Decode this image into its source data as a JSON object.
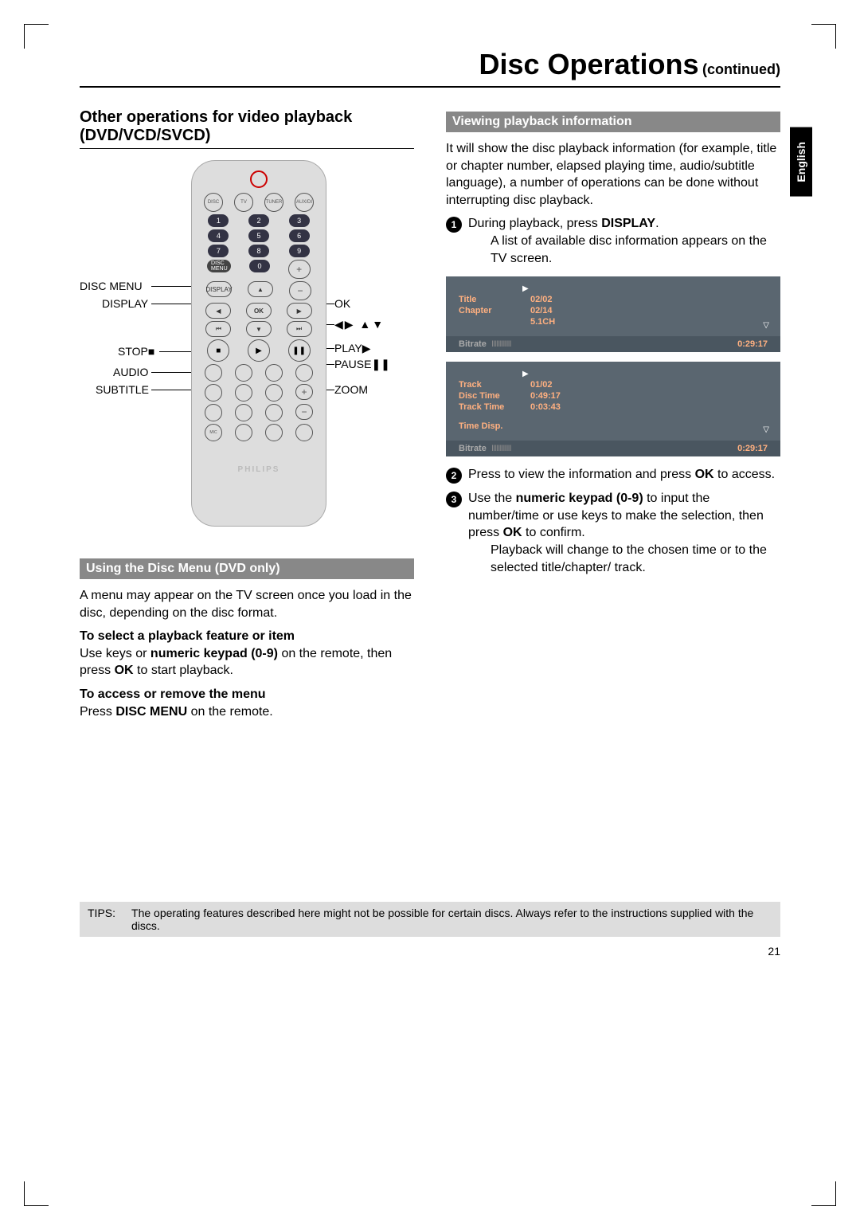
{
  "page": {
    "title_main": "Disc Operations",
    "title_sub": "(continued)",
    "lang_tab": "English",
    "page_number": "21"
  },
  "left": {
    "heading": "Other operations for video playback (DVD/VCD/SVCD)",
    "remote_labels": {
      "disc_menu": "DISC MENU",
      "display": "DISPLAY",
      "stop": "STOP",
      "audio": "AUDIO",
      "subtitle": "SUBTITLE",
      "ok": "OK",
      "arrows": "◀▶ ▲▼",
      "play": "PLAY",
      "pause": "PAUSE",
      "zoom": "ZOOM"
    },
    "sub1": "Using the Disc Menu (DVD only)",
    "p1": "A menu may appear on the TV screen once you load in the disc, depending on the disc format.",
    "p2_bold": "To select a playback feature or item",
    "p2a": "Use ",
    "p2b": " keys or ",
    "p2c": "numeric keypad (0-9)",
    "p2d": " on the remote, then press ",
    "p2e": "OK",
    "p2f": " to start playback.",
    "p3_bold": "To access or remove the menu",
    "p3a": "Press ",
    "p3b": "DISC MENU",
    "p3c": " on the remote."
  },
  "right": {
    "sub1": "Viewing playback information",
    "p1": "It will show the disc playback information (for example, title or chapter number, elapsed playing time, audio/subtitle language), a number of operations can be done without interrupting disc playback.",
    "step1a": "During playback, press ",
    "step1b": "DISPLAY",
    "step1c": ".",
    "step1d": "A list of available disc information appears on the TV screen.",
    "osd1": {
      "title_k": "Title",
      "title_v": "02/02",
      "chapter_k": "Chapter",
      "chapter_v": "02/14",
      "audio_v": "5.1CH",
      "bitrate": "Bitrate",
      "bars": "IIIIIIIIIIII",
      "time": "0:29:17"
    },
    "osd2": {
      "track_k": "Track",
      "track_v": "01/02",
      "disctime_k": "Disc Time",
      "disctime_v": "0:49:17",
      "tracktime_k": "Track Time",
      "tracktime_v": "0:03:43",
      "timedisp_k": "Time Disp.",
      "bitrate": "Bitrate",
      "bars": "IIIIIIIIIIII",
      "time": "0:29:17"
    },
    "step2a": "Press ",
    "step2b": " to view the information and press ",
    "step2c": "OK",
    "step2d": " to access.",
    "step3a": "Use the ",
    "step3b": "numeric keypad (0-9)",
    "step3c": " to input the number/time or use ",
    "step3d": " keys to make the selection, then press ",
    "step3e": "OK",
    "step3f": " to confirm.",
    "step3g": "Playback will change to the chosen time or to the selected title/chapter/ track."
  },
  "tips": {
    "label": "TIPS:",
    "text": "The operating features described here might not be possible for certain discs. Always refer to the instructions supplied with the discs."
  }
}
